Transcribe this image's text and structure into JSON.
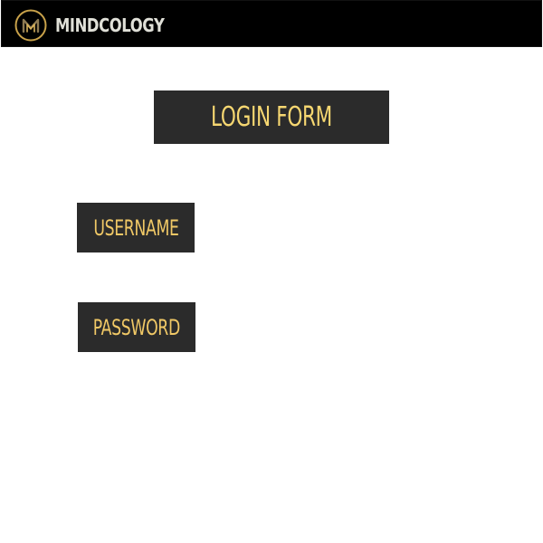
{
  "header": {
    "brand_name": "MINDCOLOGY",
    "logo_icon": "mindcology-logo-icon"
  },
  "form": {
    "title": "LOGIN FORM",
    "username_label": "USERNAME",
    "password_label": "PASSWORD"
  },
  "colors": {
    "header_background": "#000000",
    "box_background": "#2b2b2b",
    "title_text": "#f6d771",
    "label_text": "#f0c866",
    "logo_gold": "#c9a24a",
    "brand_text": "#e0e0d8"
  }
}
